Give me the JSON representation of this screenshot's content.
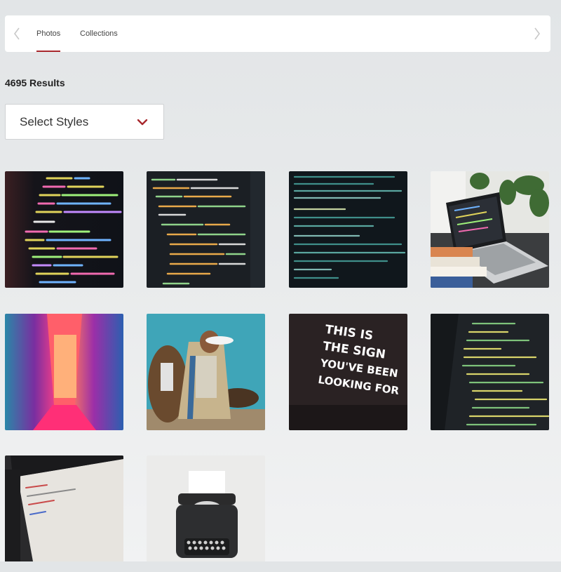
{
  "tabs": [
    {
      "label": "Photos",
      "active": true
    },
    {
      "label": "Collections",
      "active": false
    }
  ],
  "results": {
    "text": "4695 Results"
  },
  "filter": {
    "label": "Select Styles",
    "icon": "chevron-down-icon"
  },
  "colors": {
    "accent": "#a8282d"
  },
  "photos": [
    {
      "subject": "code-screen-colorful"
    },
    {
      "subject": "code-editor-dark"
    },
    {
      "subject": "code-terminal"
    },
    {
      "subject": "laptop-desk-plants"
    },
    {
      "subject": "neon-hallway"
    },
    {
      "subject": "native-dancer"
    },
    {
      "subject": "neon-sign",
      "sign_text": [
        "THIS IS",
        "THE SIGN",
        "YOU'VE BEEN",
        "LOOKING FOR"
      ]
    },
    {
      "subject": "html-code-editor"
    },
    {
      "subject": "monitor-webpage"
    },
    {
      "subject": "typewriter"
    }
  ]
}
